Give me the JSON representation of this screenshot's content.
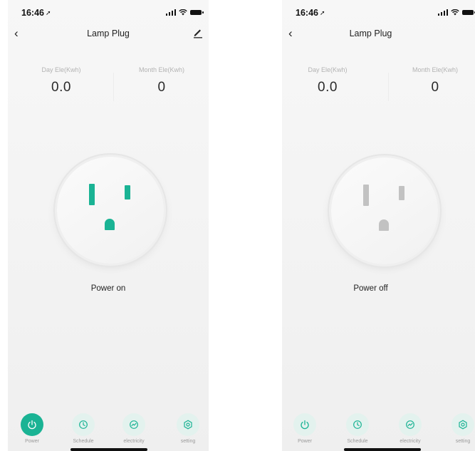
{
  "colors": {
    "accent": "#1ab394",
    "accent_light": "#e3f2ee",
    "socket_off": "#c2c2c2",
    "text_dark": "#222222",
    "text_muted": "#b3b3b3"
  },
  "screens": [
    {
      "status": {
        "time": "16:46",
        "location_icon": "location-arrow-icon"
      },
      "nav": {
        "title": "Lamp Plug",
        "back_icon": "chevron-left-icon",
        "edit_icon": "edit-pencil-icon"
      },
      "energy": {
        "day_label": "Day Ele(Kwh)",
        "day_value": "0.0",
        "month_label": "Month Ele(Kwh)",
        "month_value": "0"
      },
      "socket_state": "on",
      "power_status": "Power on",
      "tabs": [
        {
          "label": "Power",
          "icon": "power-icon",
          "active": true
        },
        {
          "label": "Schedule",
          "icon": "clock-icon"
        },
        {
          "label": "electricity",
          "icon": "chart-trend-icon"
        },
        {
          "label": "setting",
          "icon": "gear-icon"
        }
      ]
    },
    {
      "status": {
        "time": "16:46",
        "location_icon": "location-arrow-icon"
      },
      "nav": {
        "title": "Lamp Plug",
        "back_icon": "chevron-left-icon"
      },
      "energy": {
        "day_label": "Day Ele(Kwh)",
        "day_value": "0.0",
        "month_label": "Month Ele(Kwh)",
        "month_value": "0"
      },
      "socket_state": "off",
      "power_status": "Power off",
      "tabs": [
        {
          "label": "Power",
          "icon": "power-icon",
          "active": false
        },
        {
          "label": "Schedule",
          "icon": "clock-icon"
        },
        {
          "label": "electricity",
          "icon": "chart-trend-icon"
        },
        {
          "label": "setting",
          "icon": "gear-icon"
        }
      ]
    }
  ]
}
